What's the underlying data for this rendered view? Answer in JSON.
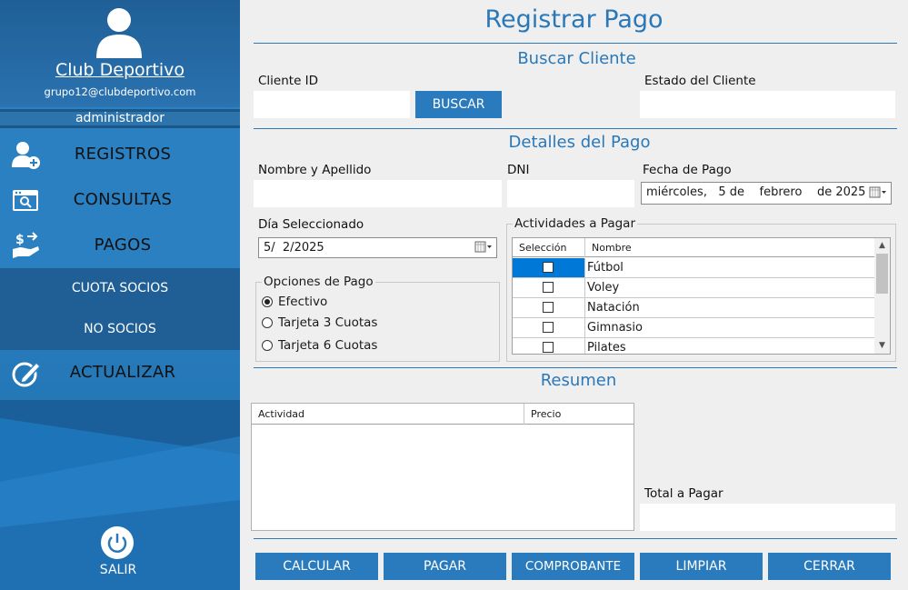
{
  "sidebar": {
    "club_name": "Club Deportivo",
    "email": "grupo12@clubdeportivo.com",
    "role": "administrador",
    "nav": {
      "registros": "REGISTROS",
      "consultas": "CONSULTAS",
      "pagos": "PAGOS",
      "actualizar": "ACTUALIZAR"
    },
    "submenu": {
      "cuota_socios": "CUOTA SOCIOS",
      "no_socios": "NO SOCIOS"
    },
    "salir": "SALIR"
  },
  "page": {
    "title": "Registrar Pago"
  },
  "buscar": {
    "section_title": "Buscar Cliente",
    "cliente_id_label": "Cliente ID",
    "cliente_id_value": "",
    "buscar_button": "BUSCAR",
    "estado_label": "Estado del Cliente",
    "estado_value": ""
  },
  "detalles": {
    "section_title": "Detalles del Pago",
    "nombre_label": "Nombre y Apellido",
    "nombre_value": "",
    "dni_label": "DNI",
    "dni_value": "",
    "fecha_label": "Fecha de Pago",
    "fecha_value": "miércoles,   5 de    febrero    de 2025",
    "dia_label": "Día Seleccionado",
    "dia_value": "5/  2/2025",
    "opciones_title": "Opciones de Pago",
    "opciones": [
      "Efectivo",
      "Tarjeta 3 Cuotas",
      "Tarjeta 6 Cuotas"
    ],
    "opcion_seleccionada": "Efectivo",
    "actividades_title": "Actividades a Pagar",
    "actividades_headers": [
      "Selección",
      "Nombre"
    ],
    "actividades": [
      "Fútbol",
      "Voley",
      "Natación",
      "Gimnasio",
      "Pilates"
    ]
  },
  "resumen": {
    "section_title": "Resumen",
    "headers": [
      "Actividad",
      "Precio"
    ],
    "total_label": "Total a Pagar",
    "total_value": ""
  },
  "actions": {
    "calcular": "CALCULAR",
    "pagar": "PAGAR",
    "comprobante": "COMPROBANTE",
    "limpiar": "LIMPIAR",
    "cerrar": "CERRAR"
  },
  "colors": {
    "accent": "#2a7bbd",
    "sidebar_dark": "#1f5f96",
    "selection": "#0078d7"
  }
}
